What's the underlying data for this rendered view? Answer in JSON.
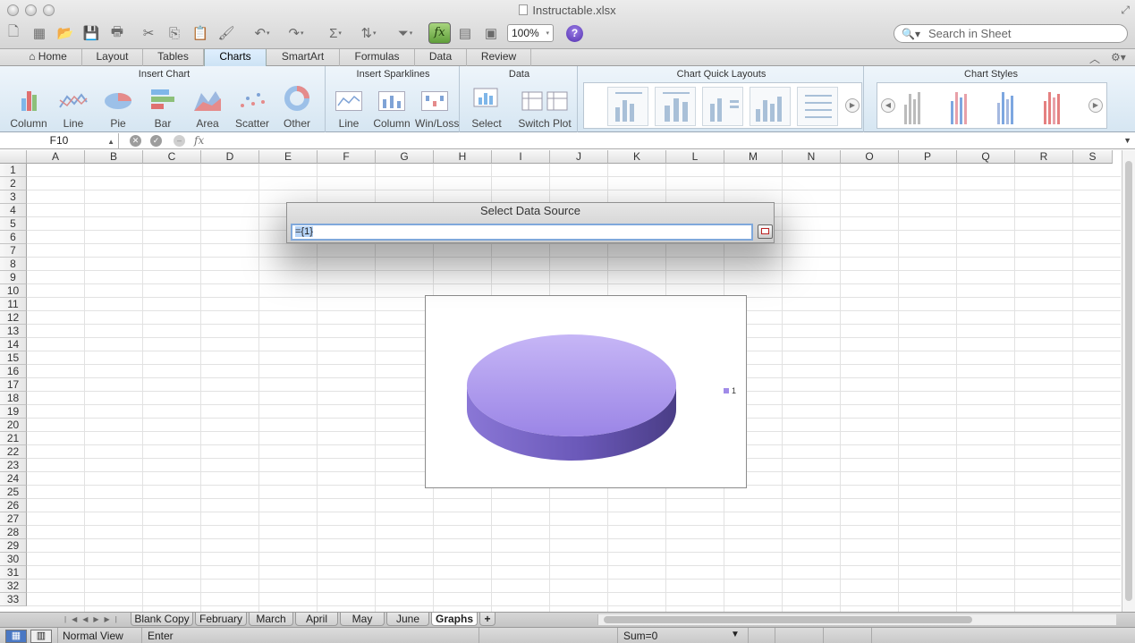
{
  "window": {
    "title": "Instructable.xlsx"
  },
  "toolbar": {
    "zoom": "100%",
    "function_label": "fx",
    "help_label": "?",
    "search_placeholder": "Search in Sheet"
  },
  "ribbon_tabs": [
    "Home",
    "Layout",
    "Tables",
    "Charts",
    "SmartArt",
    "Formulas",
    "Data",
    "Review"
  ],
  "active_ribbon_tab": "Charts",
  "ribbon": {
    "insert_chart": {
      "title": "Insert Chart",
      "buttons": [
        "Column",
        "Line",
        "Pie",
        "Bar",
        "Area",
        "Scatter",
        "Other"
      ]
    },
    "insert_sparklines": {
      "title": "Insert Sparklines",
      "buttons": [
        "Line",
        "Column",
        "Win/Loss"
      ]
    },
    "data": {
      "title": "Data",
      "buttons": [
        "Select",
        "Switch Plot"
      ]
    },
    "quick_layouts": {
      "title": "Chart Quick Layouts"
    },
    "chart_styles": {
      "title": "Chart Styles",
      "colors": [
        "#bbbbbb",
        "#7da7e0",
        "#e8a0a8",
        "#a4b8e0",
        "#e58080"
      ]
    }
  },
  "formula_bar": {
    "name_box": "F10",
    "fx": "fx",
    "formula": ""
  },
  "columns": [
    "A",
    "B",
    "C",
    "D",
    "E",
    "F",
    "G",
    "H",
    "I",
    "J",
    "K",
    "L",
    "M",
    "N",
    "O",
    "P",
    "Q",
    "R",
    "S"
  ],
  "rows": [
    "1",
    "2",
    "3",
    "4",
    "5",
    "6",
    "7",
    "8",
    "9",
    "10",
    "11",
    "12",
    "13",
    "14",
    "15",
    "16",
    "17",
    "18",
    "19",
    "20",
    "21",
    "22",
    "23",
    "24",
    "25",
    "26",
    "27",
    "28",
    "29",
    "30",
    "31",
    "32",
    "33"
  ],
  "dialog": {
    "title": "Select Data Source",
    "value": "={1}"
  },
  "chart_data": {
    "type": "pie",
    "categories": [
      "1"
    ],
    "values": [
      1
    ],
    "legend": "right",
    "colors": [
      "#a08be8"
    ]
  },
  "sheets": [
    "Blank Copy",
    "February",
    "March",
    "April",
    "May",
    "June",
    "Graphs"
  ],
  "active_sheet": "Graphs",
  "add_sheet_label": "+",
  "status": {
    "view": "Normal View",
    "mode": "Enter",
    "sum": "Sum=0"
  }
}
